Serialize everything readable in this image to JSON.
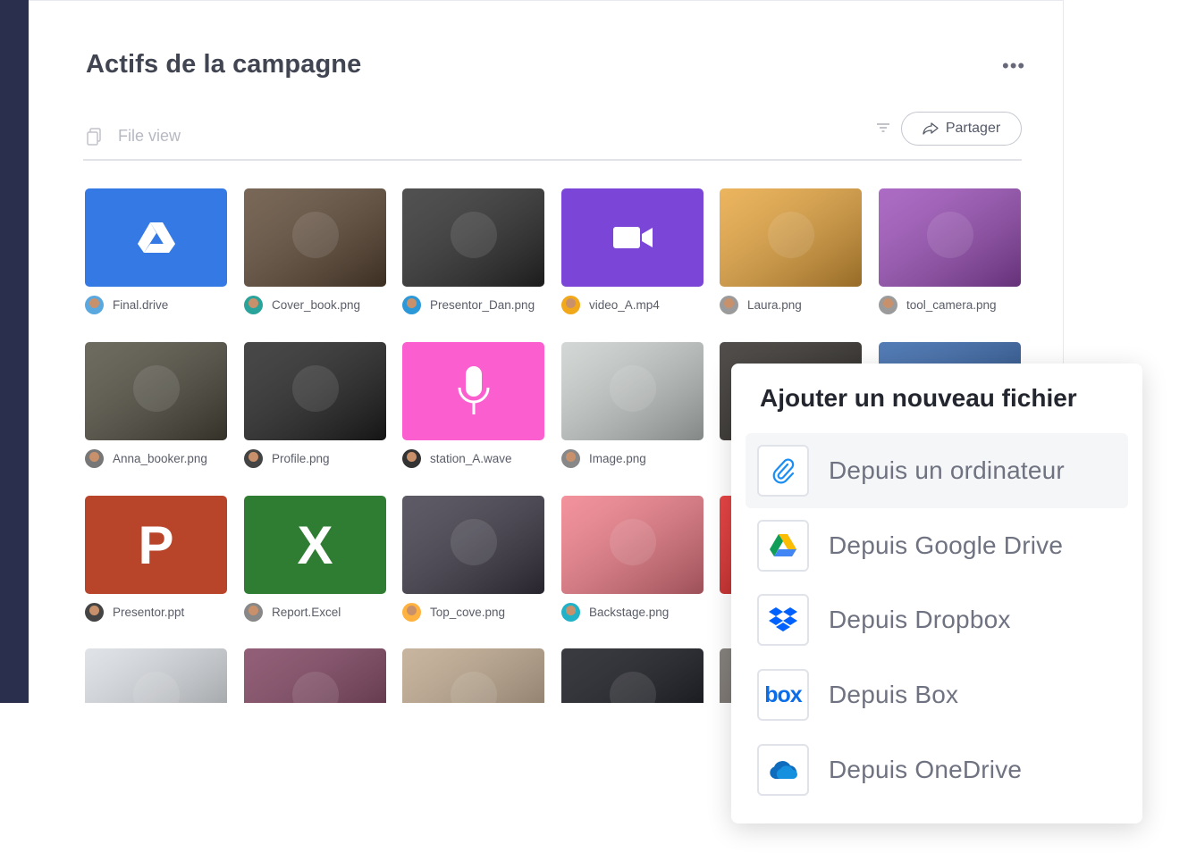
{
  "board": {
    "title": "Actifs de la campagne",
    "more_label": "•••",
    "view_label": "File view",
    "share_label": "Partager"
  },
  "files": [
    {
      "name": "Final.drive",
      "kind": "drive",
      "bg": "#3579e5"
    },
    {
      "name": "Cover_book.png",
      "kind": "photo",
      "bg": "#5b4632"
    },
    {
      "name": "Presentor_Dan.png",
      "kind": "photo",
      "bg": "#2a2a2a"
    },
    {
      "name": "video_A.mp4",
      "kind": "video",
      "bg": "#7b46d8"
    },
    {
      "name": "Laura.png",
      "kind": "photo",
      "bg": "#e7a43a"
    },
    {
      "name": "tool_camera.png",
      "kind": "photo",
      "bg": "#9a4bb8"
    },
    {
      "name": "Anna_booker.png",
      "kind": "photo",
      "bg": "#4d4a3c"
    },
    {
      "name": "Profile.png",
      "kind": "photo",
      "bg": "#1f1f1f"
    },
    {
      "name": "station_A.wave",
      "kind": "audio",
      "bg": "#fb5fcf"
    },
    {
      "name": "Image.png",
      "kind": "photo",
      "bg": "#c9cfcc"
    },
    {
      "name": "",
      "kind": "photo",
      "bg": "#2a2622"
    },
    {
      "name": "",
      "kind": "photo",
      "bg": "#2d5fa6"
    },
    {
      "name": "Presentor.ppt",
      "kind": "ppt",
      "bg": "#b8442a",
      "letter": "P"
    },
    {
      "name": "Report.Excel",
      "kind": "excel",
      "bg": "#2e7d32",
      "letter": "X"
    },
    {
      "name": "Top_cove.png",
      "kind": "photo",
      "bg": "#3a3644"
    },
    {
      "name": "Backstage.png",
      "kind": "photo",
      "bg": "#f07a86"
    },
    {
      "name": "",
      "kind": "photo",
      "bg": "#e01b1b"
    },
    {
      "name": "",
      "kind": "photo",
      "bg": "#dddddd"
    },
    {
      "name": "",
      "kind": "photo",
      "bg": "#d9dde2"
    },
    {
      "name": "",
      "kind": "photo",
      "bg": "#7a3c5a"
    },
    {
      "name": "",
      "kind": "photo",
      "bg": "#bca58a"
    },
    {
      "name": "",
      "kind": "photo",
      "bg": "#0d0f16"
    },
    {
      "name": "",
      "kind": "photo",
      "bg": "#6b6560"
    },
    {
      "name": "",
      "kind": "photo",
      "bg": "#ffffff"
    }
  ],
  "popup": {
    "title": "Ajouter un nouveau fichier",
    "options": [
      {
        "label": "Depuis un ordinateur",
        "icon": "paperclip-icon"
      },
      {
        "label": "Depuis Google Drive",
        "icon": "google-drive-icon"
      },
      {
        "label": "Depuis Dropbox",
        "icon": "dropbox-icon"
      },
      {
        "label": "Depuis Box",
        "icon": "box-icon",
        "icon_text": "box"
      },
      {
        "label": "Depuis OneDrive",
        "icon": "onedrive-icon"
      }
    ]
  },
  "colors": {
    "sidebar": "#292f4c",
    "accent_blue": "#0073ea",
    "drive_blue": "#3579e5",
    "video_purple": "#7b46d8",
    "audio_pink": "#fb5fcf",
    "ppt_red": "#b8442a",
    "excel_green": "#2e7d32"
  }
}
